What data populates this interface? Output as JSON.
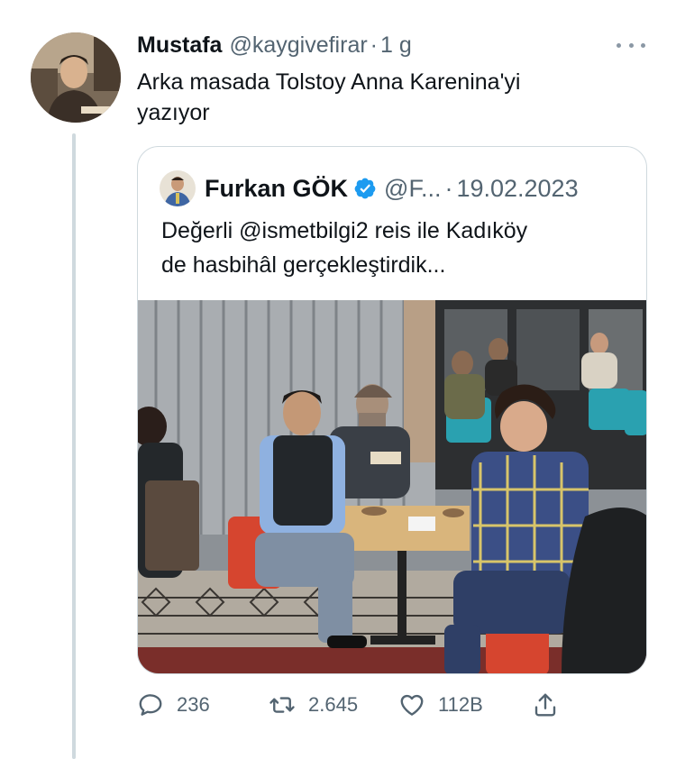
{
  "tweet": {
    "author_name": "Mustafa",
    "handle": "@kaygivefirar",
    "separator": "·",
    "time": "1 g",
    "text_line1": "Arka masada Tolstoy Anna Karenina'yi",
    "text_line2": "yazıyor"
  },
  "quote": {
    "author_name": "Furkan GÖK",
    "handle": "@F...",
    "separator": "·",
    "date": "19.02.2023",
    "text_line1": "Değerli @ismetbilgi2 reis ile Kadıköy",
    "text_line2": "de hasbihâl gerçekleştirdik..."
  },
  "actions": {
    "replies": "236",
    "retweets": "2.645",
    "likes": "112B"
  },
  "icons": [
    "more-icon",
    "verified-badge-icon",
    "reply-icon",
    "retweet-icon",
    "like-icon",
    "share-icon"
  ],
  "colors": {
    "text": "#0f1419",
    "secondary": "#536471",
    "border": "#cfd9de",
    "verified": "#1d9bf0"
  }
}
